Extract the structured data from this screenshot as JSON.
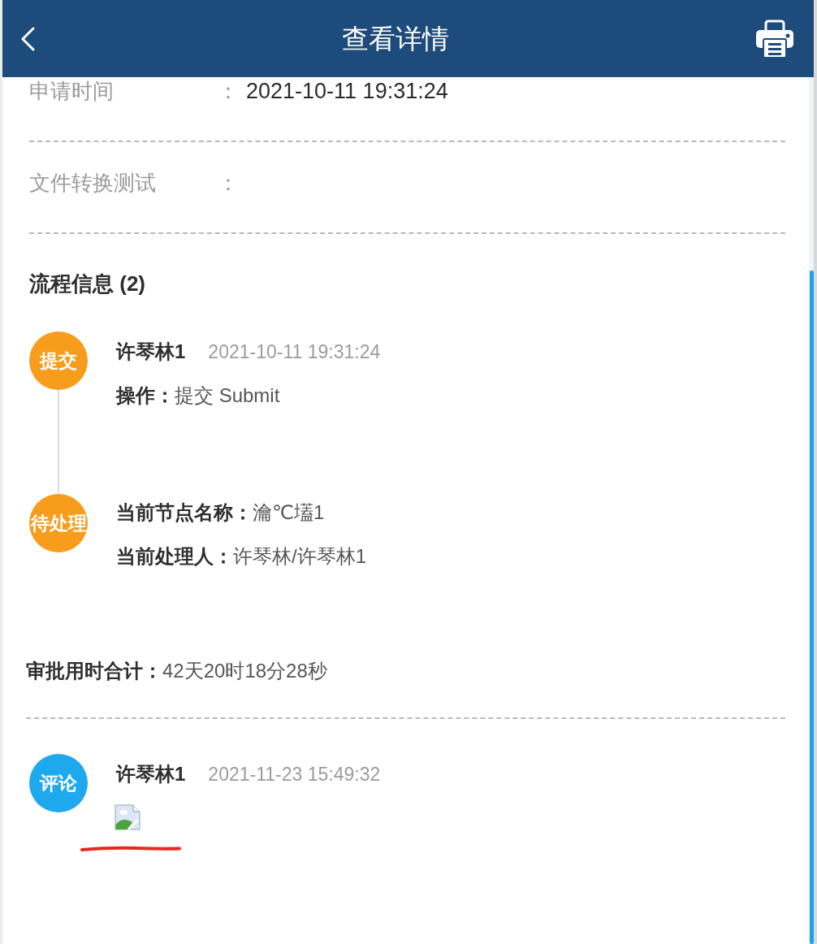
{
  "header": {
    "title": "查看详情"
  },
  "fields": [
    {
      "label": "申请时间",
      "separator": "：",
      "value": "2021-10-11 19:31:24"
    },
    {
      "label": "文件转换测试",
      "separator": "："
    }
  ],
  "process": {
    "title": "流程信息 (2)",
    "steps": [
      {
        "badge": "提交",
        "color": "#f89c1c",
        "name": "许琴林1",
        "time": "2021-10-11 19:31:24",
        "lines": [
          {
            "label": "操作：",
            "value": "提交 Submit"
          }
        ]
      },
      {
        "badge": "待处理",
        "color": "#f89c1c",
        "lines": [
          {
            "label": "当前节点名称：",
            "value": "瀹℃壒1"
          },
          {
            "label": "当前处理人：",
            "value": "许琴林/许琴林1"
          }
        ]
      }
    ]
  },
  "total": {
    "label": "审批用时合计：",
    "value": "42天20时18分28秒"
  },
  "comments": [
    {
      "badge": "评论",
      "color": "#1ea8ee",
      "name": "许琴林1",
      "time": "2021-11-23 15:49:32",
      "kind": "image"
    }
  ]
}
